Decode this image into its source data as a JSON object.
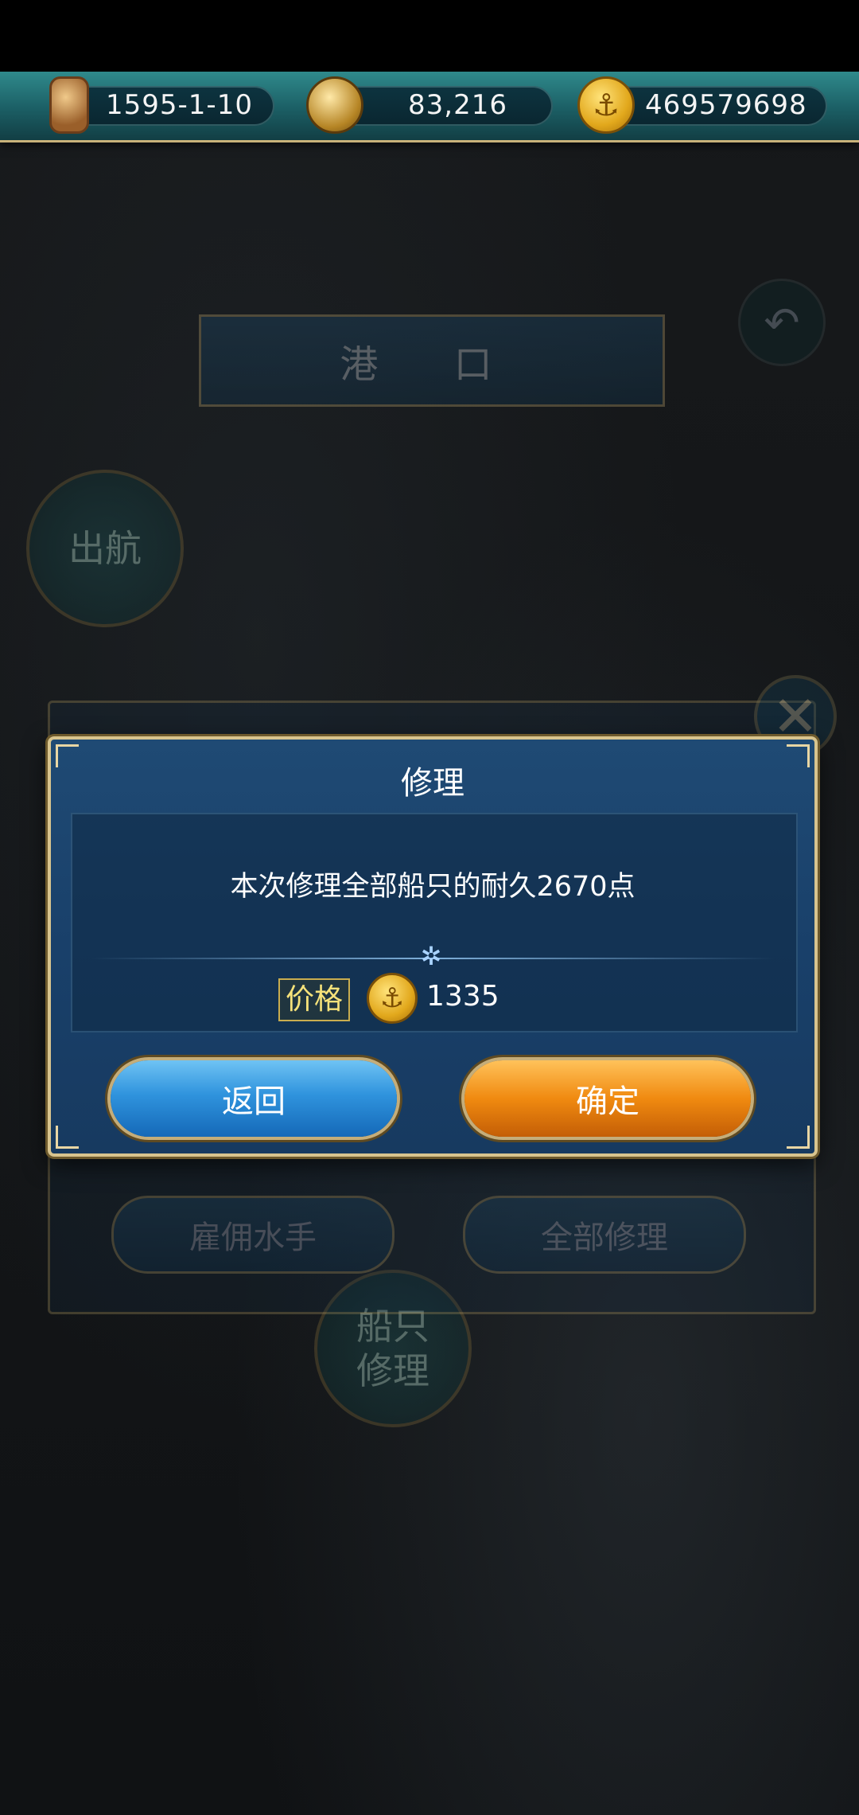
{
  "hud": {
    "date": "1595-1-10",
    "compass_value": "83,216",
    "gold": "469579698",
    "icons": [
      "hourglass-icon",
      "compass-icon",
      "anchor-coin-icon"
    ]
  },
  "background": {
    "banner_title": "港 口",
    "sail_button": "出航",
    "ship_repair_button": "船只\n修理",
    "hire_sailors_button": "雇佣水手",
    "repair_all_button": "全部修理"
  },
  "dialog": {
    "title": "修理",
    "message": "本次修理全部船只的耐久2670点",
    "price_label": "价格",
    "price_value": "1335",
    "back_label": "返回",
    "confirm_label": "确定"
  },
  "colors": {
    "hud_teal": "#1b5e64",
    "dialog_blue": "#1f4a74",
    "back_button_blue": "#2f93dd",
    "confirm_button_orange": "#f08a10",
    "gold_border": "#d8c48e",
    "price_label_yellow": "#f6e27a"
  }
}
